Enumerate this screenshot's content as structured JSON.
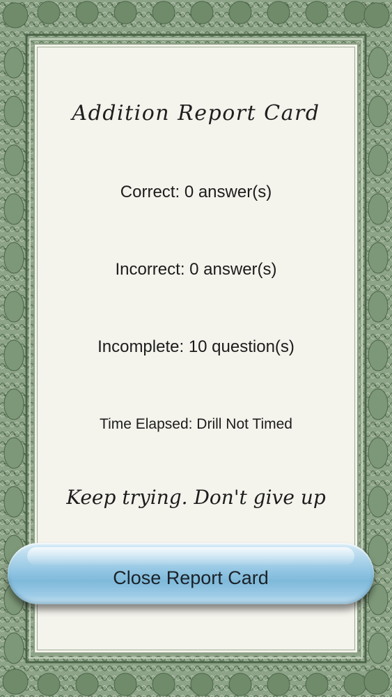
{
  "report": {
    "title": "Addition Report Card",
    "correct": "Correct: 0 answer(s)",
    "incorrect": "Incorrect: 0 answer(s)",
    "incomplete": "Incomplete: 10 question(s)",
    "time_elapsed": "Time Elapsed: Drill Not Timed",
    "message": "Keep trying. Don't give up"
  },
  "actions": {
    "close_label": "Close Report Card"
  },
  "colors": {
    "border_dark": "#5f7a5b",
    "border_light": "#a9bba2",
    "paper": "#f4f3ec",
    "button_blue": "#8fc4e2"
  }
}
